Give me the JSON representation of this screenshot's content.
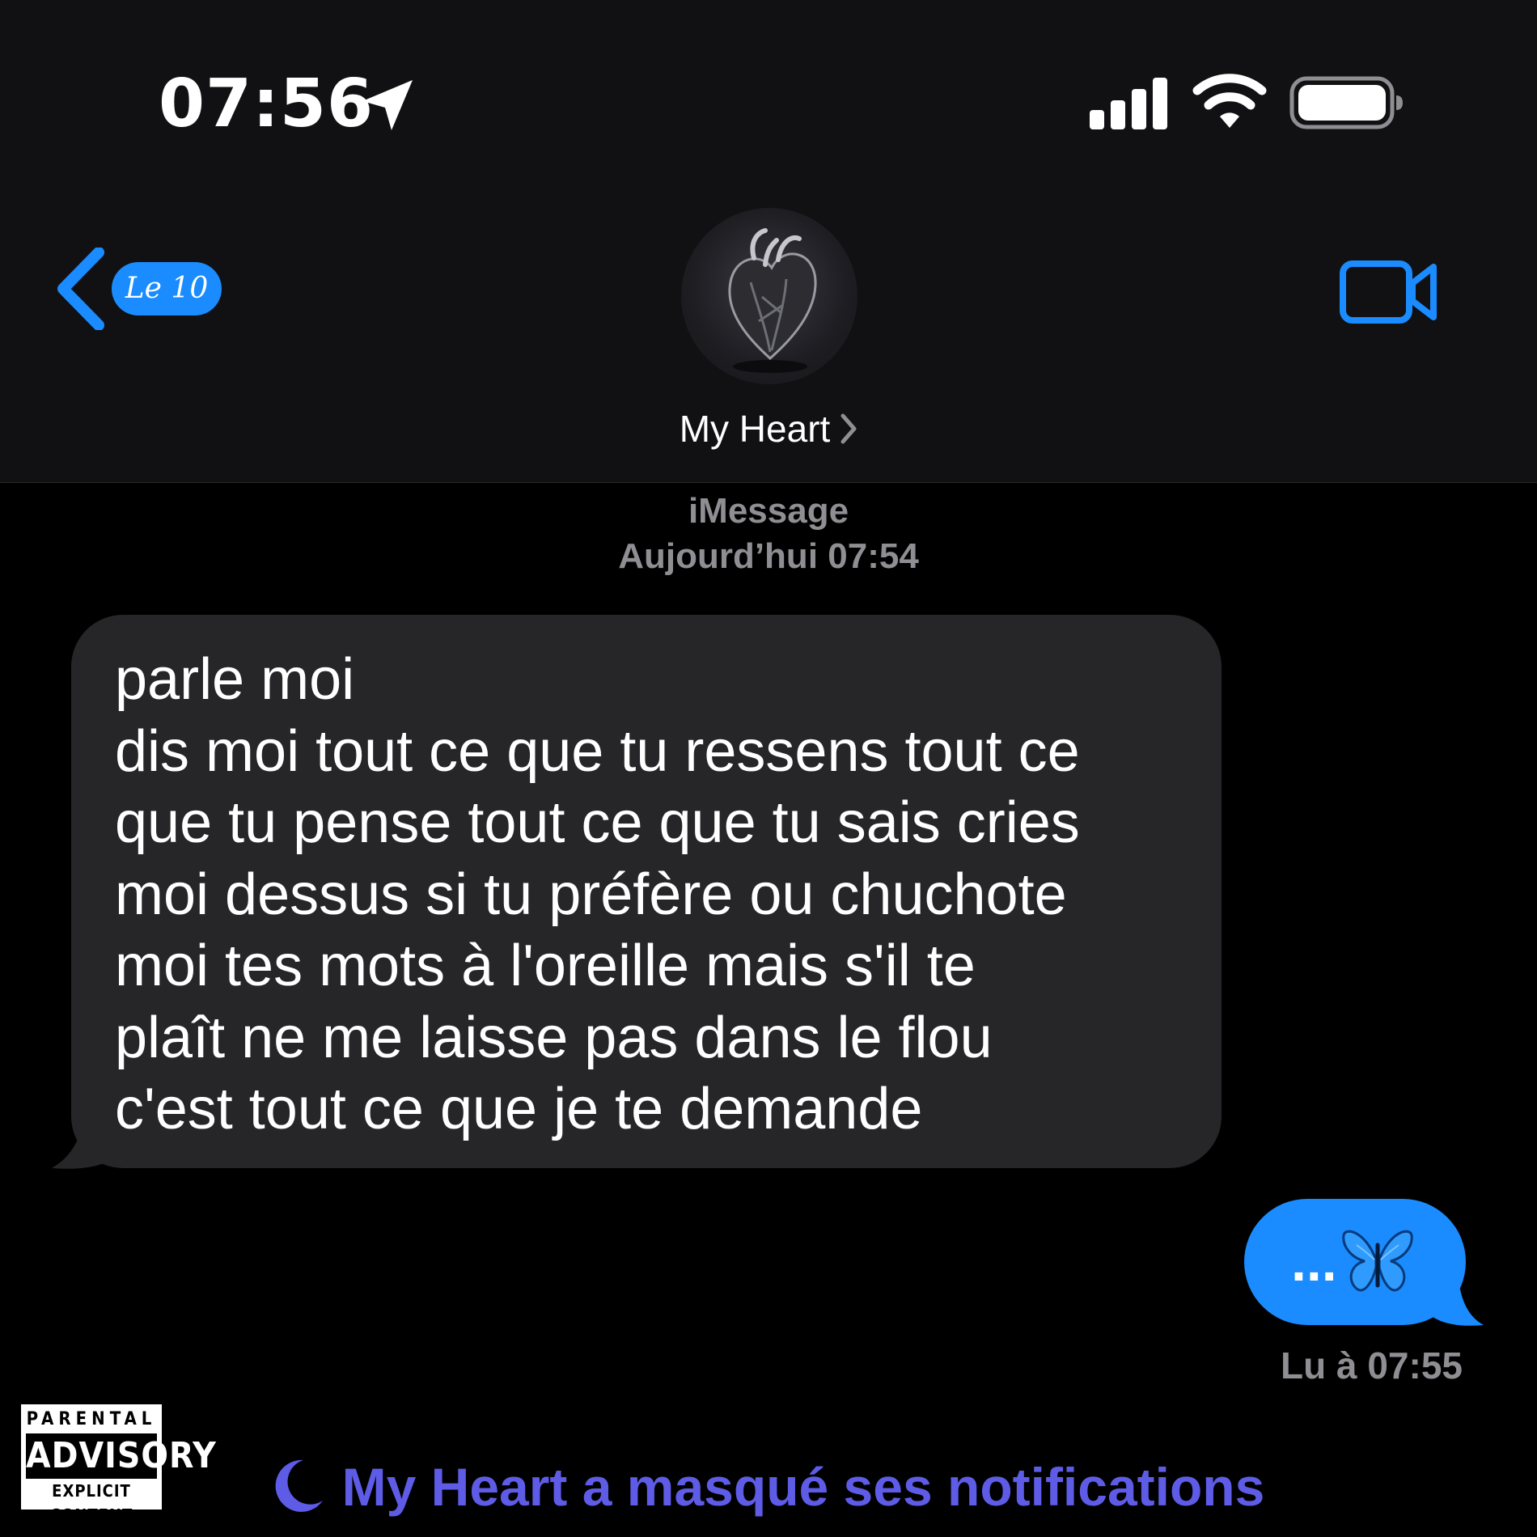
{
  "status_bar": {
    "time": "07:56",
    "icons": [
      "location-arrow-icon",
      "cellular-signal-icon",
      "wifi-icon",
      "battery-icon"
    ]
  },
  "header": {
    "back_badge_label": "Le 10",
    "contact_name": "My Heart",
    "avatar": "dark-anatomical-heart-avatar",
    "video_icon": "video-camera-icon"
  },
  "conversation": {
    "service": "iMessage",
    "date": "Aujourd’hui 07:54",
    "incoming_message": "parle moi\ndis moi tout ce que tu ressens tout ce\nque tu pense tout ce que tu sais cries\nmoi dessus si tu préfère ou chuchote\nmoi tes mots à l'oreille mais s'il te\nplaît ne me laisse pas dans le flou\nc'est tout ce que je te demande",
    "outgoing_message": "...",
    "outgoing_emoji": "blue-butterfly-icon",
    "read_receipt": "Lu à 07:55"
  },
  "footer": {
    "advisory_top": "PARENTAL",
    "advisory_mid": "ADVISORY",
    "advisory_bottom": "EXPLICIT CONTENT",
    "focus_banner": "My Heart a masqué ses notifications",
    "focus_icon": "moon-icon"
  },
  "colors": {
    "accent_blue": "#1a8cff",
    "incoming_bubble": "#262629",
    "secondary_text": "#8e8e93",
    "focus_purple": "#5e5ce6",
    "header_bg": "#111113"
  }
}
